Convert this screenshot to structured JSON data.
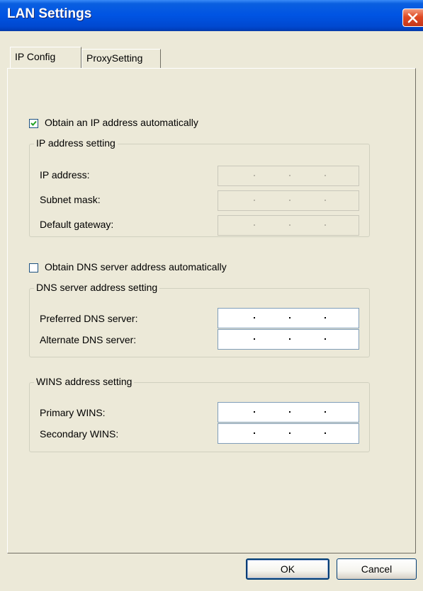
{
  "window": {
    "title": "LAN Settings"
  },
  "tabs": [
    {
      "label": "IP Config",
      "active": true
    },
    {
      "label": "ProxySetting",
      "active": false
    }
  ],
  "ip": {
    "auto_label": "Obtain an IP address automatically",
    "auto_checked": true,
    "group_label": "IP address setting",
    "fields": [
      {
        "label": "IP address:",
        "value": "",
        "enabled": false
      },
      {
        "label": "Subnet mask:",
        "value": "",
        "enabled": false
      },
      {
        "label": "Default gateway:",
        "value": "",
        "enabled": false
      }
    ]
  },
  "dns": {
    "auto_label": "Obtain DNS server address automatically",
    "auto_checked": false,
    "group_label": "DNS server address setting",
    "fields": [
      {
        "label": "Preferred DNS server:",
        "value": "",
        "enabled": true
      },
      {
        "label": "Alternate DNS server:",
        "value": "",
        "enabled": true
      }
    ]
  },
  "wins": {
    "group_label": "WINS address setting",
    "fields": [
      {
        "label": "Primary WINS:",
        "value": "",
        "enabled": true
      },
      {
        "label": "Secondary WINS:",
        "value": "",
        "enabled": true
      }
    ]
  },
  "buttons": {
    "ok": "OK",
    "cancel": "Cancel"
  },
  "icons": {
    "close": "close-icon",
    "check": "check-icon"
  },
  "colors": {
    "titlebar": "#0054e3",
    "face": "#ece9d8",
    "close": "#e04a24"
  }
}
